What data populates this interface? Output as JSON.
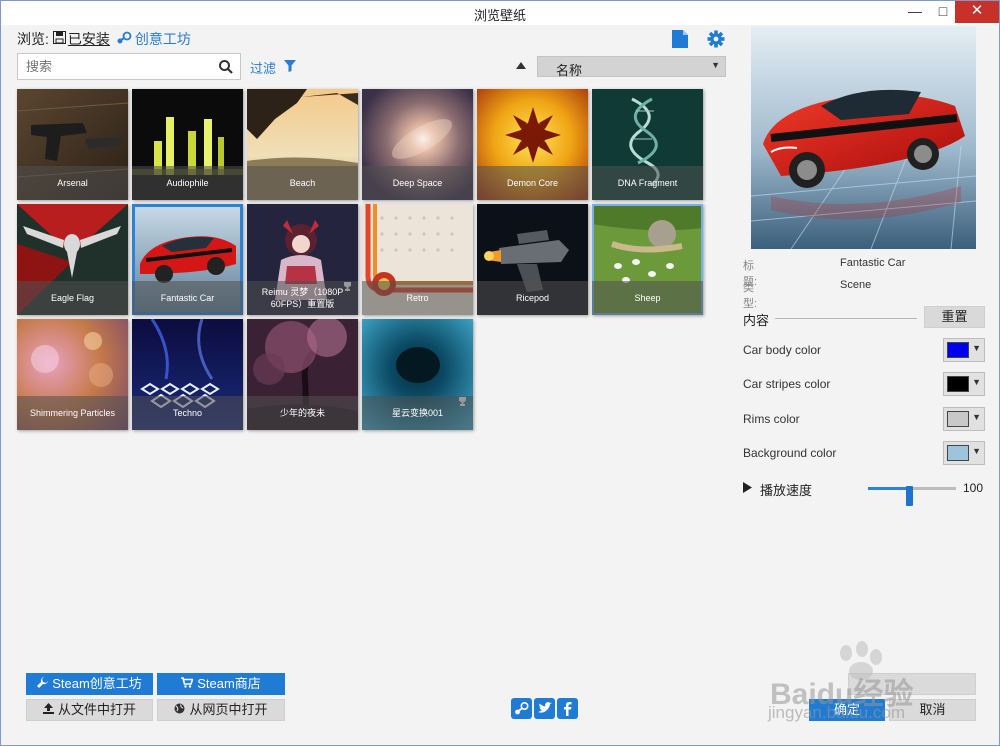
{
  "window": {
    "title": "浏览壁纸",
    "minimize": "—",
    "maximize": "□",
    "close": "✕"
  },
  "browse": {
    "label": "浏览:",
    "installed": "已安装",
    "workshop": "创意工坊"
  },
  "search": {
    "placeholder": "搜索"
  },
  "filter": {
    "label": "过滤"
  },
  "sort": {
    "value": "名称"
  },
  "wallpapers": [
    {
      "name": "Arsenal"
    },
    {
      "name": "Audiophile"
    },
    {
      "name": "Beach"
    },
    {
      "name": "Deep Space"
    },
    {
      "name": "Demon Core"
    },
    {
      "name": "DNA Fragment"
    },
    {
      "name": "Eagle Flag"
    },
    {
      "name": "Fantastic Car"
    },
    {
      "name": "Reimu 灵梦（1080P 60FPS）重置版"
    },
    {
      "name": "Retro"
    },
    {
      "name": "Ricepod"
    },
    {
      "name": "Sheep"
    },
    {
      "name": "Shimmering Particles"
    },
    {
      "name": "Techno"
    },
    {
      "name": "少年的夜未"
    },
    {
      "name": "星云变换001"
    }
  ],
  "details": {
    "title_label": "标题:",
    "title_value": "Fantastic Car",
    "type_label": "类型:",
    "type_value": "Scene",
    "content_label": "内容",
    "reset_label": "重置"
  },
  "properties": [
    {
      "label": "Car body color",
      "color": "#0000ee"
    },
    {
      "label": "Car stripes color",
      "color": "#000000"
    },
    {
      "label": "Rims color",
      "color": "#c8c8c8"
    },
    {
      "label": "Background color",
      "color": "#9ec3dc"
    }
  ],
  "speed": {
    "label": "播放速度",
    "value": 100,
    "fraction": 0.47
  },
  "buttons": {
    "steam_workshop": "Steam创意工坊",
    "steam_store": "Steam商店",
    "open_file": "从文件中打开",
    "open_web": "从网页中打开",
    "ok": "确定",
    "cancel": "取消"
  },
  "watermark": {
    "brand": "Baidu经验",
    "url": "jingyan.baidu.com"
  },
  "colors": {
    "accent": "#1f7bd4",
    "selected_outline": "#2e82d6",
    "close": "#c7312a"
  }
}
